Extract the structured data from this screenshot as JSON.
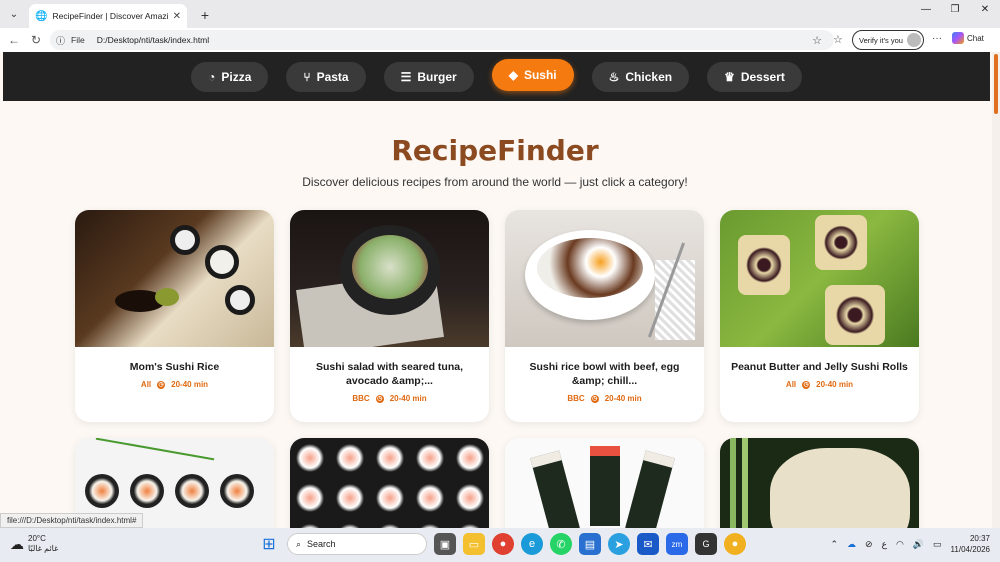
{
  "browser": {
    "tab_title": "RecipeFinder | Discover Amazing R",
    "url_scheme": "File",
    "url": "D:/Desktop/nti/task/index.html",
    "verify_label": "Verify it's you",
    "chat_label": "Chat"
  },
  "nav": {
    "categories": [
      {
        "label": "Pizza",
        "icon": "pizza-icon",
        "glyph": "◔"
      },
      {
        "label": "Pasta",
        "icon": "fork-knife-icon",
        "glyph": "🍴"
      },
      {
        "label": "Burger",
        "icon": "burger-icon",
        "glyph": "≡"
      },
      {
        "label": "Sushi",
        "icon": "fish-icon",
        "glyph": "🐟"
      },
      {
        "label": "Chicken",
        "icon": "drumstick-icon",
        "glyph": "♨"
      },
      {
        "label": "Dessert",
        "icon": "cake-icon",
        "glyph": "♛"
      }
    ],
    "active": "Sushi",
    "accent": "#f57a10"
  },
  "hero": {
    "title": "RecipeFinder",
    "subtitle": "Discover delicious recipes from around the world — just click a category!"
  },
  "recipes": [
    {
      "name": "Mom's Sushi Rice",
      "source": "All",
      "time": "20-40 min"
    },
    {
      "name": "Sushi salad with seared tuna, avocado &amp;...",
      "source": "BBC",
      "time": "20-40 min"
    },
    {
      "name": "Sushi rice bowl with beef, egg &amp; chill...",
      "source": "BBC",
      "time": "20-40 min"
    },
    {
      "name": "Peanut Butter and Jelly Sushi Rolls",
      "source": "All",
      "time": "20-40 min"
    }
  ],
  "status_url": "file:///D:/Desktop/nti/task/index.html#",
  "taskbar": {
    "temperature": "20°C",
    "weather_text": "غائم غالبًا",
    "search_label": "Search",
    "time": "20:37",
    "date": "11/04/2026",
    "lang": "ع"
  }
}
